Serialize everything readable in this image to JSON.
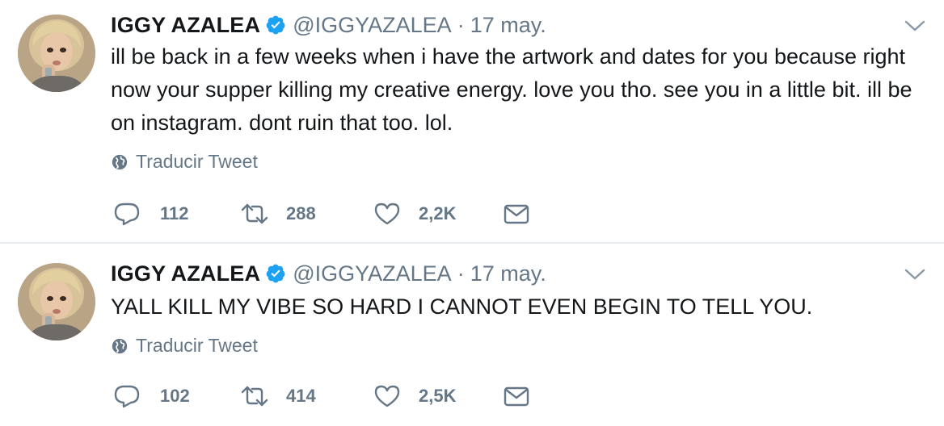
{
  "tweets": [
    {
      "author_name": "IGGY AZALEA",
      "handle": "@IGGYAZALEA",
      "separator": "·",
      "date": "17 may.",
      "text": "ill be back in a few weeks when i have the artwork and dates for you because right now your supper killing my creative energy. love you tho. see you in a little bit. ill be on instagram. dont ruin that too. lol.",
      "translate_label": "Traducir Tweet",
      "replies": "112",
      "retweets": "288",
      "likes": "2,2K"
    },
    {
      "author_name": "IGGY AZALEA",
      "handle": "@IGGYAZALEA",
      "separator": "·",
      "date": "17 may.",
      "text": "YALL KILL MY VIBE SO HARD I CANNOT EVEN BEGIN TO TELL YOU.",
      "translate_label": "Traducir Tweet",
      "replies": "102",
      "retweets": "414",
      "likes": "2,5K"
    }
  ],
  "colors": {
    "verified_blue": "#1da1f2",
    "muted_text": "#657786",
    "primary_text": "#14171a",
    "divider": "#e6ecf0"
  },
  "icons": [
    "verified-badge-icon",
    "chevron-down-icon",
    "globe-icon",
    "reply-icon",
    "retweet-icon",
    "like-heart-icon",
    "direct-message-icon"
  ]
}
